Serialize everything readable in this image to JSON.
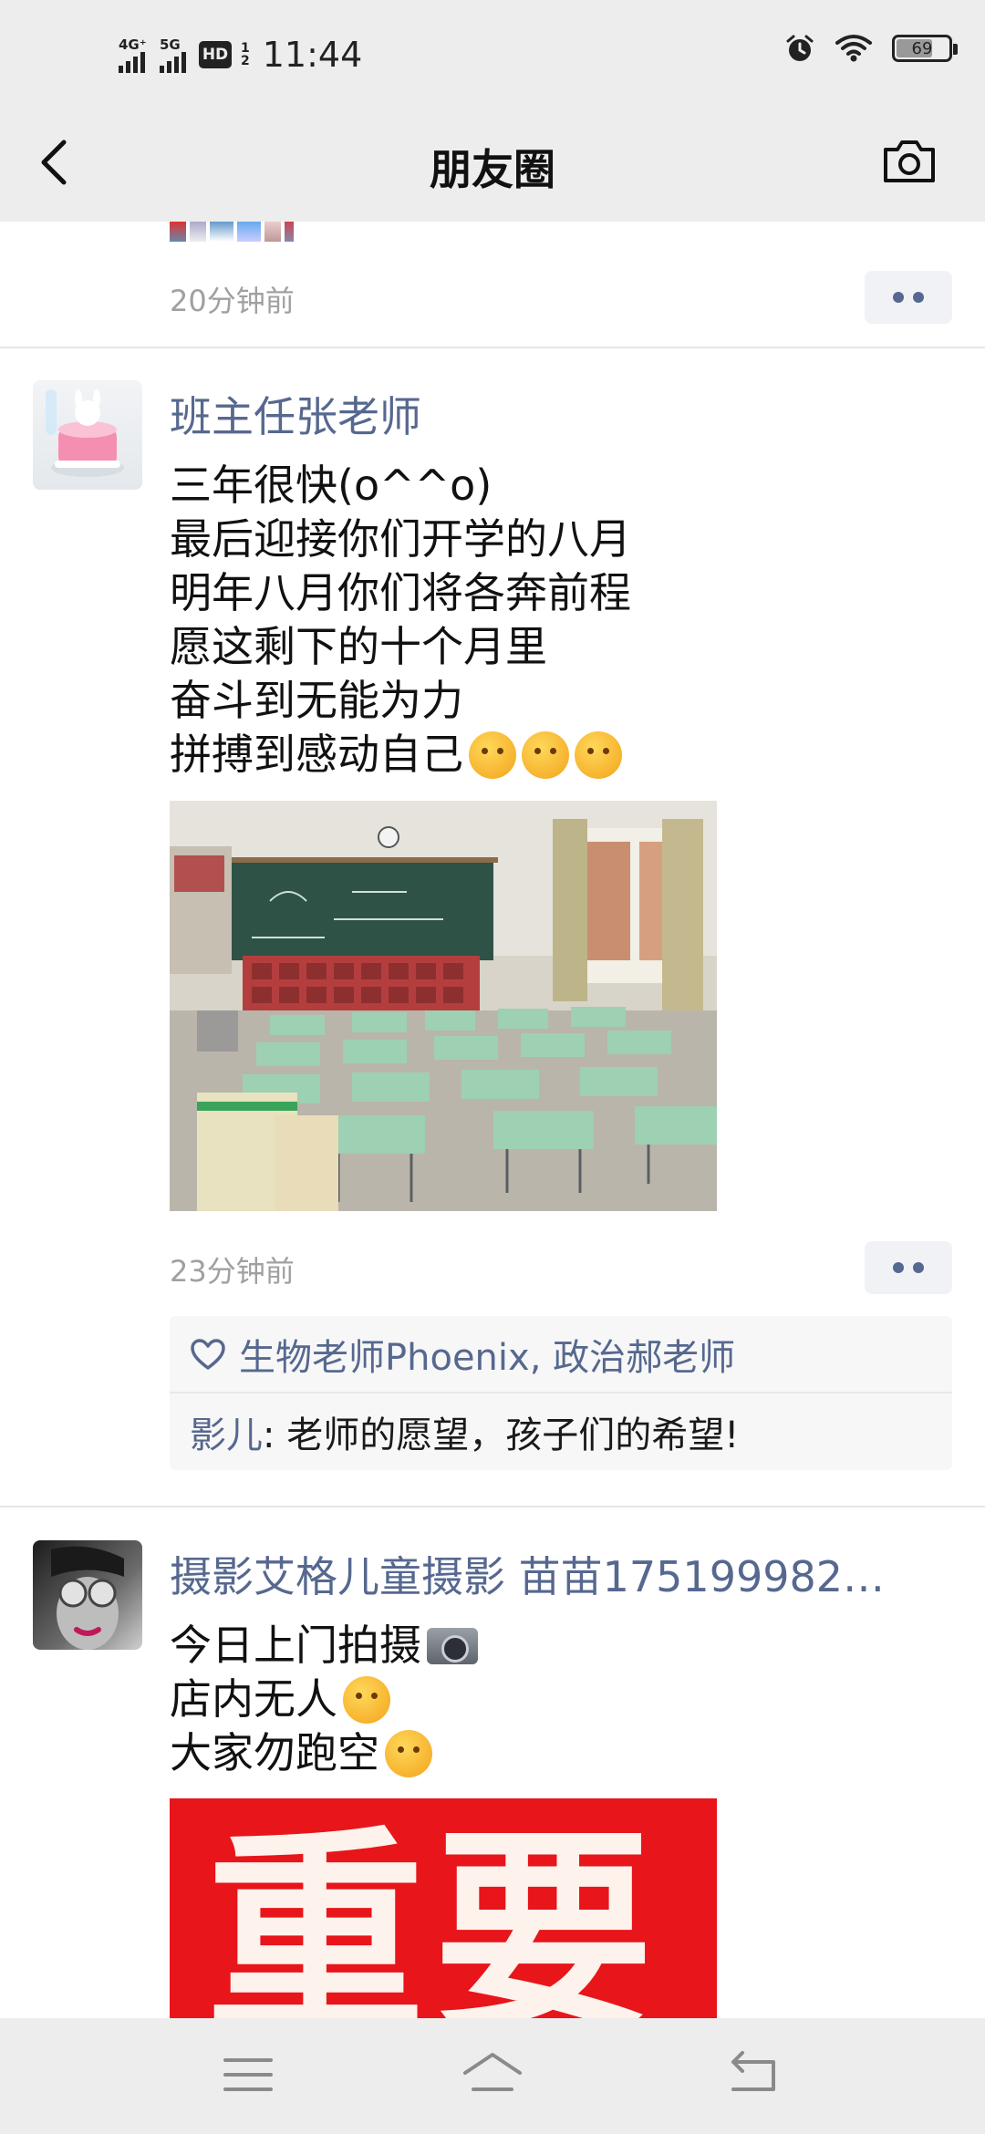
{
  "status_bar": {
    "network_1": "4G⁺",
    "network_2": "5G",
    "hd_label": "HD",
    "hd_sub_1": "1",
    "hd_sub_2": "2",
    "time": "11:44",
    "battery_level": 69,
    "battery_text": "69",
    "icons": [
      "alarm-icon",
      "wifi-icon",
      "battery-icon"
    ]
  },
  "nav": {
    "title": "朋友圈",
    "back_icon": "chevron-left-icon",
    "camera_icon": "camera-icon"
  },
  "posts": [
    {
      "time": "20分钟前"
    },
    {
      "author": "班主任张老师",
      "lines": [
        "三年很快(o^^o)",
        "最后迎接你们开学的八月",
        "明年八月你们将各奔前程",
        "愿这剩下的十个月里",
        "奋斗到无能为力",
        "拼搏到感动自己"
      ],
      "time": "23分钟前",
      "likes": "生物老师Phoenix, 政治郝老师",
      "comment": {
        "author": "影儿",
        "text": ": 老师的愿望，孩子们的希望!"
      }
    },
    {
      "author": "摄影艾格儿童摄影 苗苗175199982…",
      "lines": [
        "今日上门拍摄",
        "店内无人",
        "大家勿跑空"
      ],
      "image_text": "重要"
    }
  ],
  "colors": {
    "name_blue": "#56688f",
    "bar_gray": "#ededed",
    "time_gray": "#a0a0a0",
    "poster_red": "#e8151b"
  }
}
